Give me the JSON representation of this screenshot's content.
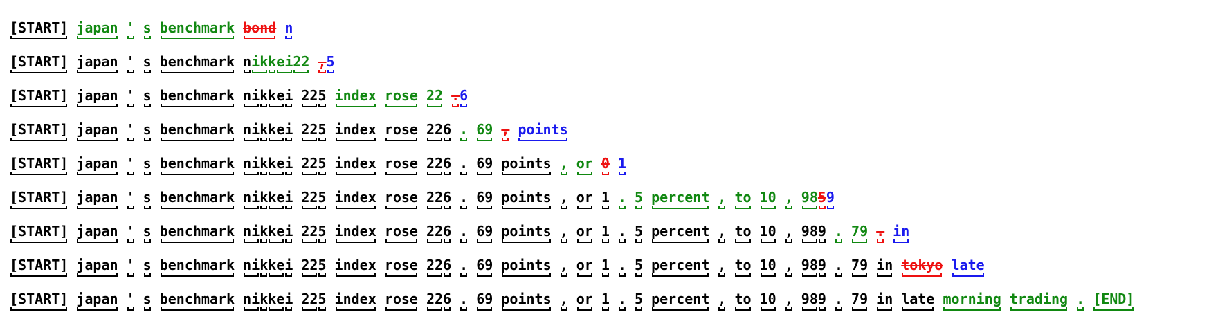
{
  "colors": {
    "kept": "#000000",
    "added": "#118811",
    "deleted": "#ee1111",
    "next": "#1a1aee"
  },
  "rows": [
    [
      {
        "t": "[START]",
        "k": "keep",
        "s": 1
      },
      {
        "t": "japan",
        "k": "new",
        "s": 1
      },
      {
        "t": "'",
        "k": "new",
        "s": 1
      },
      {
        "t": "s",
        "k": "new",
        "s": 1
      },
      {
        "t": "benchmark",
        "k": "new",
        "s": 1
      },
      {
        "t": "bond",
        "k": "del",
        "s": 1
      },
      {
        "t": "n",
        "k": "next",
        "s": 1
      }
    ],
    [
      {
        "t": "[START]",
        "k": "keep",
        "s": 1
      },
      {
        "t": "japan",
        "k": "keep",
        "s": 1
      },
      {
        "t": "'",
        "k": "keep",
        "s": 1
      },
      {
        "t": "s",
        "k": "keep",
        "s": 1
      },
      {
        "t": "benchmark",
        "k": "keep",
        "s": 1
      },
      {
        "t": "n",
        "k": "keep",
        "s": 1,
        "glue": 1
      },
      {
        "t": "ikkei",
        "k": "new",
        "s": 3,
        "glue": 1
      },
      {
        "t": "22",
        "k": "new",
        "s": 1
      },
      {
        "t": ",",
        "k": "del",
        "s": 1,
        "glue": 1
      },
      {
        "t": "5",
        "k": "next",
        "s": 1
      }
    ],
    [
      {
        "t": "[START]",
        "k": "keep",
        "s": 1
      },
      {
        "t": "japan",
        "k": "keep",
        "s": 1
      },
      {
        "t": "'",
        "k": "keep",
        "s": 1
      },
      {
        "t": "s",
        "k": "keep",
        "s": 1
      },
      {
        "t": "benchmark",
        "k": "keep",
        "s": 1
      },
      {
        "t": "nikkei",
        "k": "keep",
        "s": 4
      },
      {
        "t": "225",
        "k": "keep",
        "s": 2
      },
      {
        "t": "index",
        "k": "new",
        "s": 1
      },
      {
        "t": "rose",
        "k": "new",
        "s": 1
      },
      {
        "t": "22",
        "k": "new",
        "s": 1
      },
      {
        "t": ".",
        "k": "del",
        "s": 1,
        "glue": 1
      },
      {
        "t": "6",
        "k": "next",
        "s": 1
      }
    ],
    [
      {
        "t": "[START]",
        "k": "keep",
        "s": 1
      },
      {
        "t": "japan",
        "k": "keep",
        "s": 1
      },
      {
        "t": "'",
        "k": "keep",
        "s": 1
      },
      {
        "t": "s",
        "k": "keep",
        "s": 1
      },
      {
        "t": "benchmark",
        "k": "keep",
        "s": 1
      },
      {
        "t": "nikkei",
        "k": "keep",
        "s": 4
      },
      {
        "t": "225",
        "k": "keep",
        "s": 2
      },
      {
        "t": "index",
        "k": "keep",
        "s": 1
      },
      {
        "t": "rose",
        "k": "keep",
        "s": 1
      },
      {
        "t": "226",
        "k": "keep",
        "s": 2
      },
      {
        "t": ".",
        "k": "new",
        "s": 1
      },
      {
        "t": "69",
        "k": "new",
        "s": 1
      },
      {
        "t": ",",
        "k": "del",
        "s": 1
      },
      {
        "t": "points",
        "k": "next",
        "s": 1
      }
    ],
    [
      {
        "t": "[START]",
        "k": "keep",
        "s": 1
      },
      {
        "t": "japan",
        "k": "keep",
        "s": 1
      },
      {
        "t": "'",
        "k": "keep",
        "s": 1
      },
      {
        "t": "s",
        "k": "keep",
        "s": 1
      },
      {
        "t": "benchmark",
        "k": "keep",
        "s": 1
      },
      {
        "t": "nikkei",
        "k": "keep",
        "s": 4
      },
      {
        "t": "225",
        "k": "keep",
        "s": 2
      },
      {
        "t": "index",
        "k": "keep",
        "s": 1
      },
      {
        "t": "rose",
        "k": "keep",
        "s": 1
      },
      {
        "t": "226",
        "k": "keep",
        "s": 2
      },
      {
        "t": ".",
        "k": "keep",
        "s": 1
      },
      {
        "t": "69",
        "k": "keep",
        "s": 1
      },
      {
        "t": "points",
        "k": "keep",
        "s": 1
      },
      {
        "t": ",",
        "k": "new",
        "s": 1
      },
      {
        "t": "or",
        "k": "new",
        "s": 1
      },
      {
        "t": "0",
        "k": "del",
        "s": 1
      },
      {
        "t": "1",
        "k": "next",
        "s": 1
      }
    ],
    [
      {
        "t": "[START]",
        "k": "keep",
        "s": 1
      },
      {
        "t": "japan",
        "k": "keep",
        "s": 1
      },
      {
        "t": "'",
        "k": "keep",
        "s": 1
      },
      {
        "t": "s",
        "k": "keep",
        "s": 1
      },
      {
        "t": "benchmark",
        "k": "keep",
        "s": 1
      },
      {
        "t": "nikkei",
        "k": "keep",
        "s": 4
      },
      {
        "t": "225",
        "k": "keep",
        "s": 2
      },
      {
        "t": "index",
        "k": "keep",
        "s": 1
      },
      {
        "t": "rose",
        "k": "keep",
        "s": 1
      },
      {
        "t": "226",
        "k": "keep",
        "s": 2
      },
      {
        "t": ".",
        "k": "keep",
        "s": 1
      },
      {
        "t": "69",
        "k": "keep",
        "s": 1
      },
      {
        "t": "points",
        "k": "keep",
        "s": 1
      },
      {
        "t": ",",
        "k": "keep",
        "s": 1
      },
      {
        "t": "or",
        "k": "keep",
        "s": 1
      },
      {
        "t": "1",
        "k": "keep",
        "s": 1
      },
      {
        "t": ".",
        "k": "new",
        "s": 1
      },
      {
        "t": "5",
        "k": "new",
        "s": 1
      },
      {
        "t": "percent",
        "k": "new",
        "s": 1
      },
      {
        "t": ",",
        "k": "new",
        "s": 1
      },
      {
        "t": "to",
        "k": "new",
        "s": 1
      },
      {
        "t": "10",
        "k": "new",
        "s": 1
      },
      {
        "t": ",",
        "k": "new",
        "s": 1
      },
      {
        "t": "98",
        "k": "new",
        "s": 1,
        "glue": 1
      },
      {
        "t": "5",
        "k": "del",
        "s": 1,
        "glue": 1
      },
      {
        "t": "9",
        "k": "next",
        "s": 1
      }
    ],
    [
      {
        "t": "[START]",
        "k": "keep",
        "s": 1
      },
      {
        "t": "japan",
        "k": "keep",
        "s": 1
      },
      {
        "t": "'",
        "k": "keep",
        "s": 1
      },
      {
        "t": "s",
        "k": "keep",
        "s": 1
      },
      {
        "t": "benchmark",
        "k": "keep",
        "s": 1
      },
      {
        "t": "nikkei",
        "k": "keep",
        "s": 4
      },
      {
        "t": "225",
        "k": "keep",
        "s": 2
      },
      {
        "t": "index",
        "k": "keep",
        "s": 1
      },
      {
        "t": "rose",
        "k": "keep",
        "s": 1
      },
      {
        "t": "226",
        "k": "keep",
        "s": 2
      },
      {
        "t": ".",
        "k": "keep",
        "s": 1
      },
      {
        "t": "69",
        "k": "keep",
        "s": 1
      },
      {
        "t": "points",
        "k": "keep",
        "s": 1
      },
      {
        "t": ",",
        "k": "keep",
        "s": 1
      },
      {
        "t": "or",
        "k": "keep",
        "s": 1
      },
      {
        "t": "1",
        "k": "keep",
        "s": 1
      },
      {
        "t": ".",
        "k": "keep",
        "s": 1
      },
      {
        "t": "5",
        "k": "keep",
        "s": 1
      },
      {
        "t": "percent",
        "k": "keep",
        "s": 1
      },
      {
        "t": ",",
        "k": "keep",
        "s": 1
      },
      {
        "t": "to",
        "k": "keep",
        "s": 1
      },
      {
        "t": "10",
        "k": "keep",
        "s": 1
      },
      {
        "t": ",",
        "k": "keep",
        "s": 1
      },
      {
        "t": "989",
        "k": "keep",
        "s": 2
      },
      {
        "t": ".",
        "k": "new",
        "s": 1
      },
      {
        "t": "79",
        "k": "new",
        "s": 1
      },
      {
        "t": ".",
        "k": "del",
        "s": 1
      },
      {
        "t": "in",
        "k": "next",
        "s": 1
      }
    ],
    [
      {
        "t": "[START]",
        "k": "keep",
        "s": 1
      },
      {
        "t": "japan",
        "k": "keep",
        "s": 1
      },
      {
        "t": "'",
        "k": "keep",
        "s": 1
      },
      {
        "t": "s",
        "k": "keep",
        "s": 1
      },
      {
        "t": "benchmark",
        "k": "keep",
        "s": 1
      },
      {
        "t": "nikkei",
        "k": "keep",
        "s": 4
      },
      {
        "t": "225",
        "k": "keep",
        "s": 2
      },
      {
        "t": "index",
        "k": "keep",
        "s": 1
      },
      {
        "t": "rose",
        "k": "keep",
        "s": 1
      },
      {
        "t": "226",
        "k": "keep",
        "s": 2
      },
      {
        "t": ".",
        "k": "keep",
        "s": 1
      },
      {
        "t": "69",
        "k": "keep",
        "s": 1
      },
      {
        "t": "points",
        "k": "keep",
        "s": 1
      },
      {
        "t": ",",
        "k": "keep",
        "s": 1
      },
      {
        "t": "or",
        "k": "keep",
        "s": 1
      },
      {
        "t": "1",
        "k": "keep",
        "s": 1
      },
      {
        "t": ".",
        "k": "keep",
        "s": 1
      },
      {
        "t": "5",
        "k": "keep",
        "s": 1
      },
      {
        "t": "percent",
        "k": "keep",
        "s": 1
      },
      {
        "t": ",",
        "k": "keep",
        "s": 1
      },
      {
        "t": "to",
        "k": "keep",
        "s": 1
      },
      {
        "t": "10",
        "k": "keep",
        "s": 1
      },
      {
        "t": ",",
        "k": "keep",
        "s": 1
      },
      {
        "t": "989",
        "k": "keep",
        "s": 2
      },
      {
        "t": ".",
        "k": "keep",
        "s": 1
      },
      {
        "t": "79",
        "k": "keep",
        "s": 1
      },
      {
        "t": "in",
        "k": "keep",
        "s": 1
      },
      {
        "t": "tokyo",
        "k": "del",
        "s": 1
      },
      {
        "t": "late",
        "k": "next",
        "s": 1
      }
    ],
    [
      {
        "t": "[START]",
        "k": "keep",
        "s": 1
      },
      {
        "t": "japan",
        "k": "keep",
        "s": 1
      },
      {
        "t": "'",
        "k": "keep",
        "s": 1
      },
      {
        "t": "s",
        "k": "keep",
        "s": 1
      },
      {
        "t": "benchmark",
        "k": "keep",
        "s": 1
      },
      {
        "t": "nikkei",
        "k": "keep",
        "s": 4
      },
      {
        "t": "225",
        "k": "keep",
        "s": 2
      },
      {
        "t": "index",
        "k": "keep",
        "s": 1
      },
      {
        "t": "rose",
        "k": "keep",
        "s": 1
      },
      {
        "t": "226",
        "k": "keep",
        "s": 2
      },
      {
        "t": ".",
        "k": "keep",
        "s": 1
      },
      {
        "t": "69",
        "k": "keep",
        "s": 1
      },
      {
        "t": "points",
        "k": "keep",
        "s": 1
      },
      {
        "t": ",",
        "k": "keep",
        "s": 1
      },
      {
        "t": "or",
        "k": "keep",
        "s": 1
      },
      {
        "t": "1",
        "k": "keep",
        "s": 1
      },
      {
        "t": ".",
        "k": "keep",
        "s": 1
      },
      {
        "t": "5",
        "k": "keep",
        "s": 1
      },
      {
        "t": "percent",
        "k": "keep",
        "s": 1
      },
      {
        "t": ",",
        "k": "keep",
        "s": 1
      },
      {
        "t": "to",
        "k": "keep",
        "s": 1
      },
      {
        "t": "10",
        "k": "keep",
        "s": 1
      },
      {
        "t": ",",
        "k": "keep",
        "s": 1
      },
      {
        "t": "989",
        "k": "keep",
        "s": 2
      },
      {
        "t": ".",
        "k": "keep",
        "s": 1
      },
      {
        "t": "79",
        "k": "keep",
        "s": 1
      },
      {
        "t": "in",
        "k": "keep",
        "s": 1
      },
      {
        "t": "late",
        "k": "keep",
        "s": 1
      },
      {
        "t": "morning",
        "k": "new",
        "s": 1
      },
      {
        "t": "trading",
        "k": "new",
        "s": 1
      },
      {
        "t": ".",
        "k": "new",
        "s": 1
      },
      {
        "t": "[END]",
        "k": "new",
        "s": 1
      }
    ]
  ]
}
